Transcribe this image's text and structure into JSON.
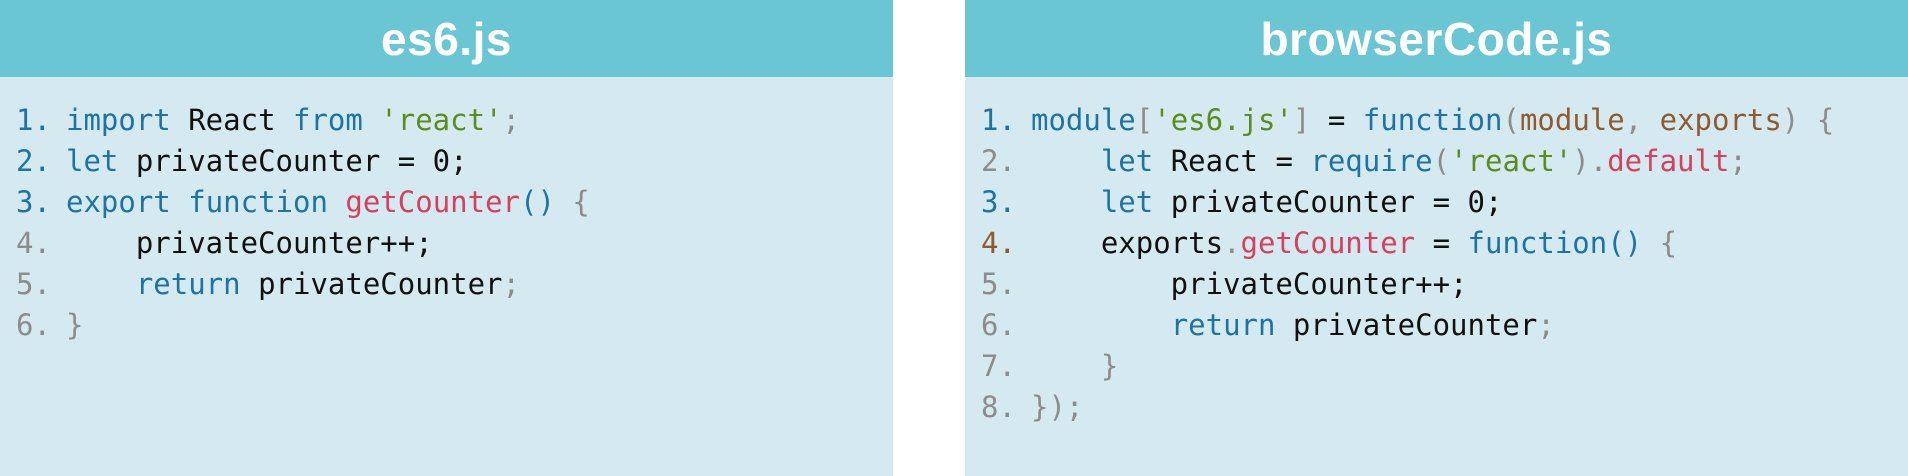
{
  "colors": {
    "header_bg": "#6ac6d2",
    "panel_bg": "#d5eaf0",
    "keyword": "#1e72a4",
    "string": "#5a8c20",
    "function_name": "#d6405f",
    "parameter": "#8f5a30",
    "punctuation": "#8c8c8c"
  },
  "left": {
    "title": "es6.js",
    "lines": [
      {
        "num": "1.",
        "parts": [
          {
            "t": "import",
            "c": "key"
          },
          {
            "t": " React ",
            "c": "plain"
          },
          {
            "t": "from",
            "c": "key"
          },
          {
            "t": " ",
            "c": "plain"
          },
          {
            "t": "'react'",
            "c": "str"
          },
          {
            "t": ";",
            "c": "punc"
          }
        ]
      },
      {
        "num": "2.",
        "parts": [
          {
            "t": "let",
            "c": "key"
          },
          {
            "t": " privateCounter = 0;",
            "c": "plain"
          }
        ]
      },
      {
        "num": "3.",
        "parts": [
          {
            "t": "export",
            "c": "key"
          },
          {
            "t": " ",
            "c": "plain"
          },
          {
            "t": "function",
            "c": "key"
          },
          {
            "t": " ",
            "c": "plain"
          },
          {
            "t": "getCounter",
            "c": "fn"
          },
          {
            "t": "()",
            "c": "key"
          },
          {
            "t": " {",
            "c": "punc"
          }
        ]
      },
      {
        "num": "4.",
        "parts": [
          {
            "t": "    privateCounter++;",
            "c": "plain"
          }
        ]
      },
      {
        "num": "5.",
        "parts": [
          {
            "t": "    ",
            "c": "plain"
          },
          {
            "t": "return",
            "c": "key"
          },
          {
            "t": " privateCounter",
            "c": "plain"
          },
          {
            "t": ";",
            "c": "punc"
          }
        ]
      },
      {
        "num": "6.",
        "parts": [
          {
            "t": "}",
            "c": "punc"
          }
        ]
      }
    ]
  },
  "right": {
    "title": "browserCode.js",
    "lines": [
      {
        "num": "1.",
        "parts": [
          {
            "t": "module",
            "c": "key"
          },
          {
            "t": "[",
            "c": "punc"
          },
          {
            "t": "'es6.js'",
            "c": "str"
          },
          {
            "t": "]",
            "c": "punc"
          },
          {
            "t": " = ",
            "c": "plain"
          },
          {
            "t": "function",
            "c": "key"
          },
          {
            "t": "(",
            "c": "punc"
          },
          {
            "t": "module",
            "c": "param"
          },
          {
            "t": ", ",
            "c": "punc"
          },
          {
            "t": "exports",
            "c": "param"
          },
          {
            "t": ") {",
            "c": "punc"
          }
        ]
      },
      {
        "num": "2.",
        "parts": [
          {
            "t": "    ",
            "c": "plain"
          },
          {
            "t": "let",
            "c": "key"
          },
          {
            "t": " React = ",
            "c": "plain"
          },
          {
            "t": "require",
            "c": "key"
          },
          {
            "t": "(",
            "c": "punc"
          },
          {
            "t": "'react'",
            "c": "str"
          },
          {
            "t": ").",
            "c": "punc"
          },
          {
            "t": "default",
            "c": "fn"
          },
          {
            "t": ";",
            "c": "punc"
          }
        ]
      },
      {
        "num": "3.",
        "parts": [
          {
            "t": "    ",
            "c": "plain"
          },
          {
            "t": "let",
            "c": "key"
          },
          {
            "t": " privateCounter = 0;",
            "c": "plain"
          }
        ]
      },
      {
        "num": "4.",
        "parts": [
          {
            "t": "    exports",
            "c": "plain"
          },
          {
            "t": ".",
            "c": "punc"
          },
          {
            "t": "getCounter",
            "c": "fn"
          },
          {
            "t": " = ",
            "c": "plain"
          },
          {
            "t": "function",
            "c": "key"
          },
          {
            "t": "()",
            "c": "key"
          },
          {
            "t": " {",
            "c": "punc"
          }
        ]
      },
      {
        "num": "5.",
        "parts": [
          {
            "t": "        privateCounter++;",
            "c": "plain"
          }
        ]
      },
      {
        "num": "6.",
        "parts": [
          {
            "t": "        ",
            "c": "plain"
          },
          {
            "t": "return",
            "c": "key"
          },
          {
            "t": " privateCounter",
            "c": "plain"
          },
          {
            "t": ";",
            "c": "punc"
          }
        ]
      },
      {
        "num": "7.",
        "parts": [
          {
            "t": "    }",
            "c": "punc"
          }
        ]
      },
      {
        "num": "8.",
        "parts": [
          {
            "t": "});",
            "c": "punc"
          }
        ]
      }
    ]
  }
}
